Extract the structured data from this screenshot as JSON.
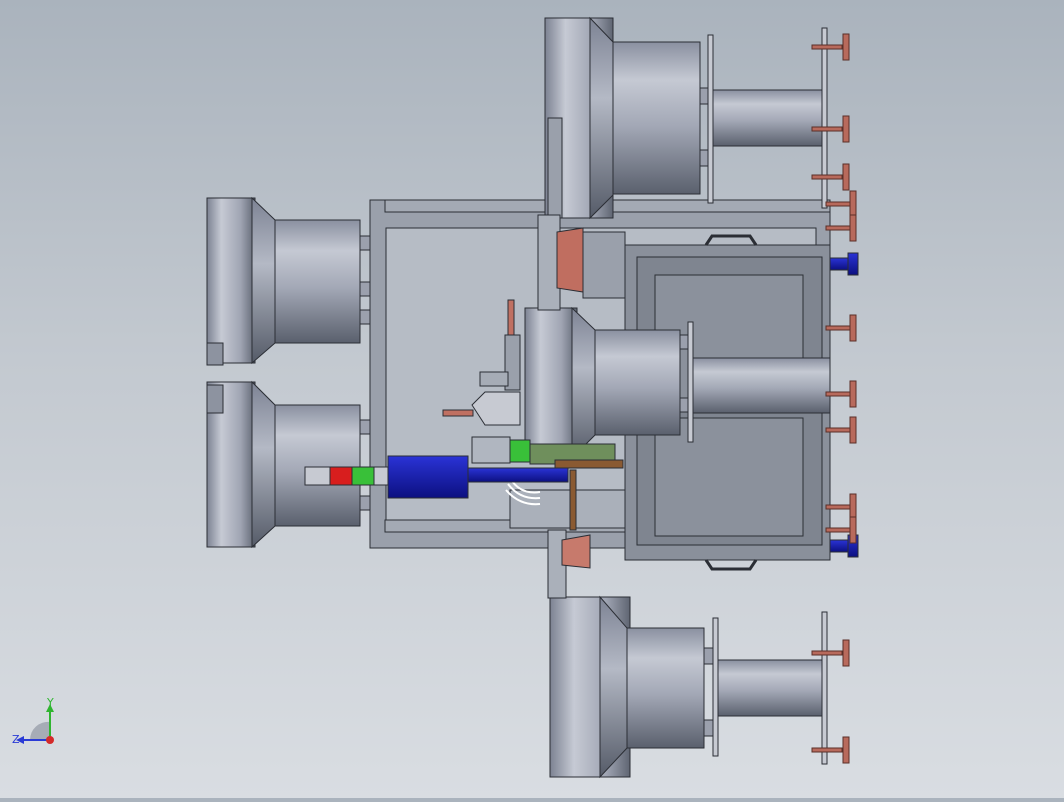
{
  "app": {
    "type": "3D CAD model viewport (orthographic side view)",
    "background": {
      "top": "#aab3bd",
      "bottom": "#d9dde2"
    }
  },
  "triad": {
    "y_label": "Y",
    "z_label": "Z",
    "colors": {
      "y": "#2fb52f",
      "z": "#2a3bd6",
      "x": "#d42a2a"
    }
  },
  "model": {
    "colors": {
      "steel_light": "#c8ccd6",
      "steel_mid": "#8c93a3",
      "steel_dark": "#4f5564",
      "frame": "#9aa0ab",
      "outline": "#2b2e35",
      "handle_red": "#b86a5c",
      "blue_motor": "#1a22b8",
      "green_part": "#39c039",
      "red_band": "#d81e1e",
      "cabinet": "#8a909b"
    }
  }
}
